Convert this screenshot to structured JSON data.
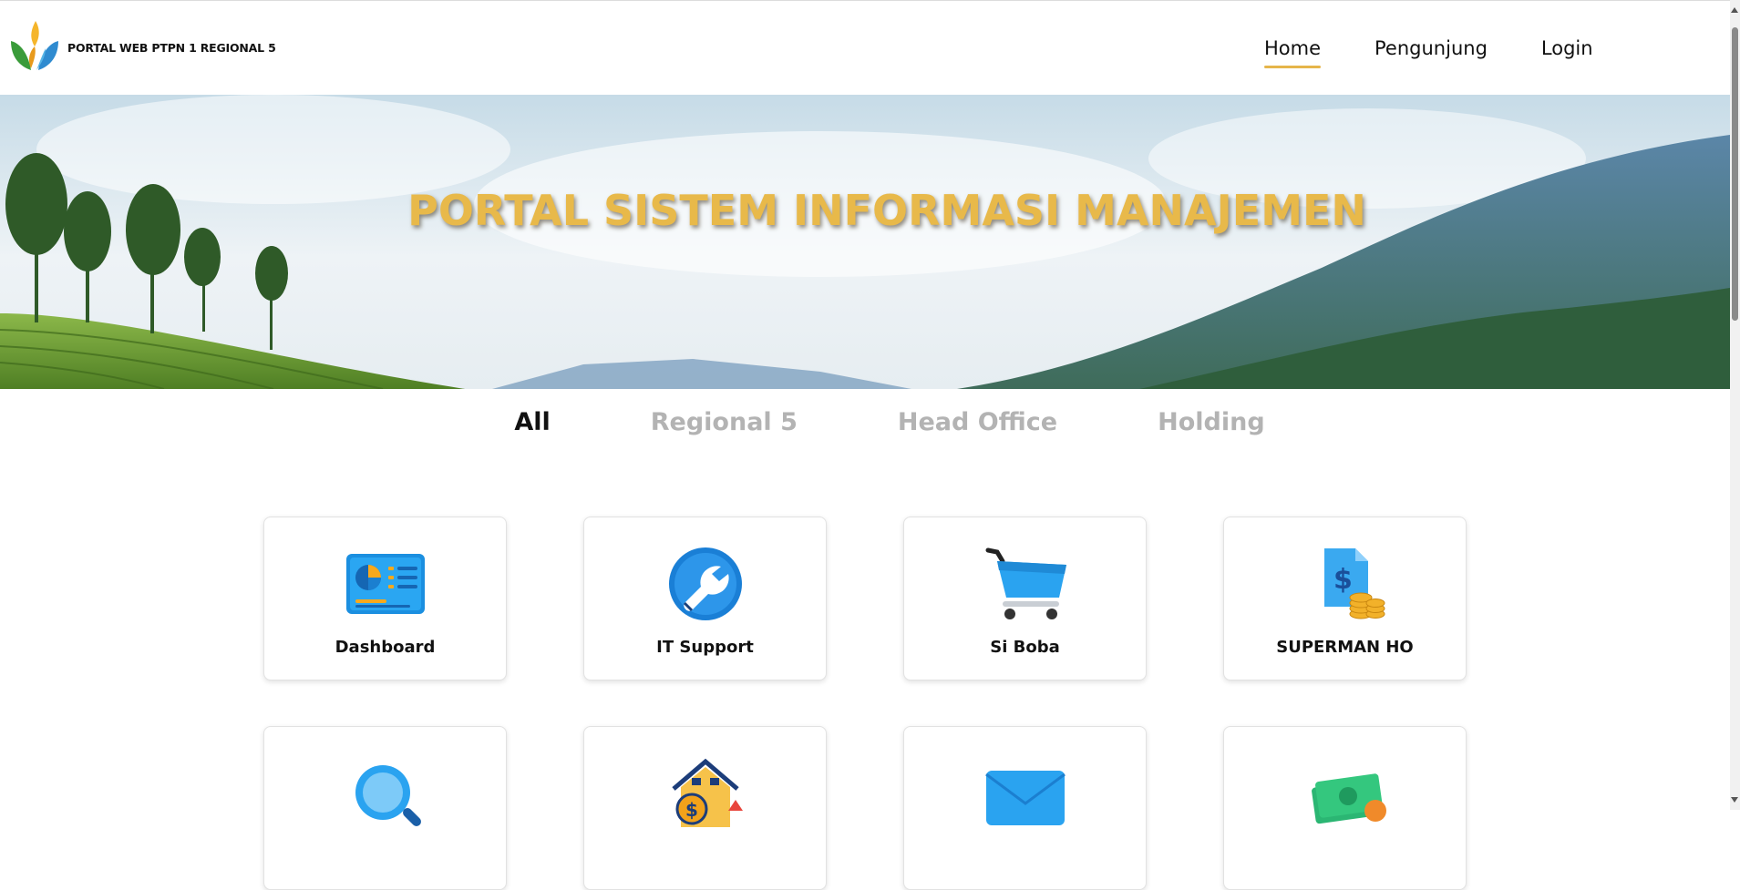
{
  "brand": {
    "name": "PORTAL WEB PTPN 1 REGIONAL 5"
  },
  "nav": {
    "links": [
      {
        "label": "Home",
        "active": true
      },
      {
        "label": "Pengunjung",
        "active": false
      },
      {
        "label": "Login",
        "active": false
      }
    ]
  },
  "hero": {
    "title": "PORTAL SISTEM INFORMASI MANAJEMEN"
  },
  "tabs": [
    {
      "label": "All",
      "active": true
    },
    {
      "label": "Regional 5",
      "active": false
    },
    {
      "label": "Head Office",
      "active": false
    },
    {
      "label": "Holding",
      "active": false
    }
  ],
  "cards": [
    {
      "label": "Dashboard",
      "icon": "dashboard-icon"
    },
    {
      "label": "IT Support",
      "icon": "wrench-icon"
    },
    {
      "label": "Si Boba",
      "icon": "shopping-cart-icon"
    },
    {
      "label": "SUPERMAN HO",
      "icon": "finance-document-icon"
    },
    {
      "label": "",
      "icon": "magnifier-icon"
    },
    {
      "label": "",
      "icon": "property-finance-icon"
    },
    {
      "label": "",
      "icon": "mail-icon"
    },
    {
      "label": "",
      "icon": "money-icon"
    }
  ],
  "colors": {
    "accent": "#e8b94a",
    "tab_inactive": "#b3b3b3",
    "text": "#111111"
  }
}
